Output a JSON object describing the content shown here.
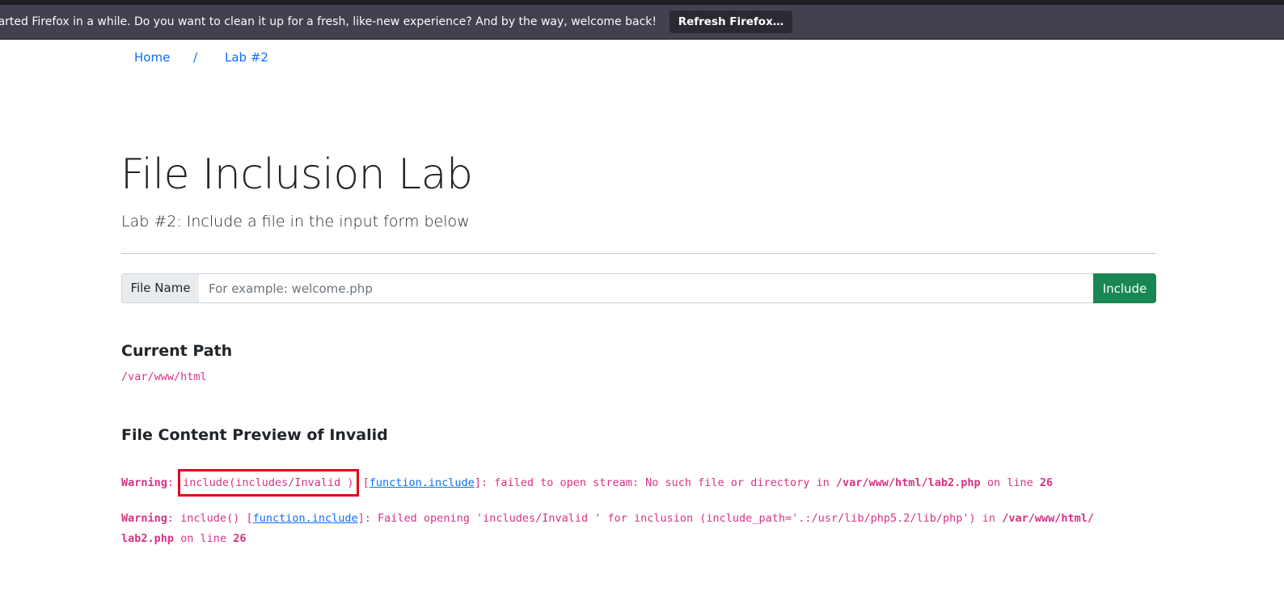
{
  "browser": {
    "notification_text": "…haven’t started Firefox in a while. Do you want to clean it up for a fresh, like-new experience? And by the way, welcome back!",
    "notification_button": "Refresh Firefox…"
  },
  "breadcrumb": {
    "home": "Home",
    "separator": "/",
    "current": "Lab #2"
  },
  "header": {
    "title": "File Inclusion Lab",
    "subtitle": "Lab #2: Include a file in the input form below"
  },
  "form": {
    "label": "File Name",
    "placeholder": "For example: welcome.php",
    "value": "",
    "submit": "Include"
  },
  "current_path": {
    "heading": "Current Path",
    "value": "/var/www/html"
  },
  "preview": {
    "heading_prefix": "File Content Preview of",
    "filename": "Invalid",
    "warnings": [
      {
        "label": "Warning",
        "call": "include(includes/Invalid )",
        "link": "function.include",
        "message": ": failed to open stream: No such file or directory in",
        "file": "/var/www/html/lab2.php",
        "line_text": "on line",
        "line": "26"
      },
      {
        "label": "Warning",
        "call": "include()",
        "link": "function.include",
        "message": ": Failed opening 'includes/Invalid ' for inclusion (include_path='.:/usr/lib/php5.2/lib/php') in",
        "file_part1": "/var/www/html/",
        "file_part2": "lab2.php",
        "line_text": "on line",
        "line": "26"
      }
    ]
  },
  "annotation": {
    "highlight_color": "#e3001b"
  }
}
